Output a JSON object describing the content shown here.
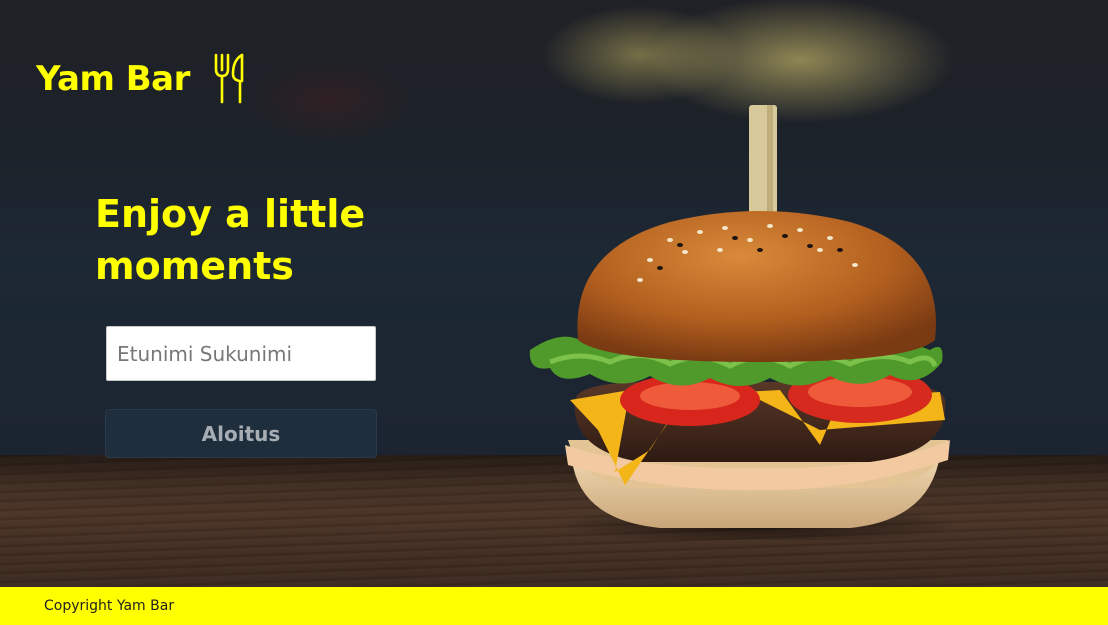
{
  "header": {
    "brand": "Yam Bar",
    "brand_icon": "fork-knife-icon"
  },
  "hero": {
    "headline": "Enjoy a little moments",
    "image": "burger-photo"
  },
  "form": {
    "name_placeholder": "Etunimi Sukunimi",
    "name_value": "",
    "start_label": "Aloitus"
  },
  "footer": {
    "copyright": "Copyright Yam Bar"
  },
  "colors": {
    "accent": "#ffff00",
    "button_bg": "#1f2e3d",
    "button_text": "#a7adb3"
  }
}
